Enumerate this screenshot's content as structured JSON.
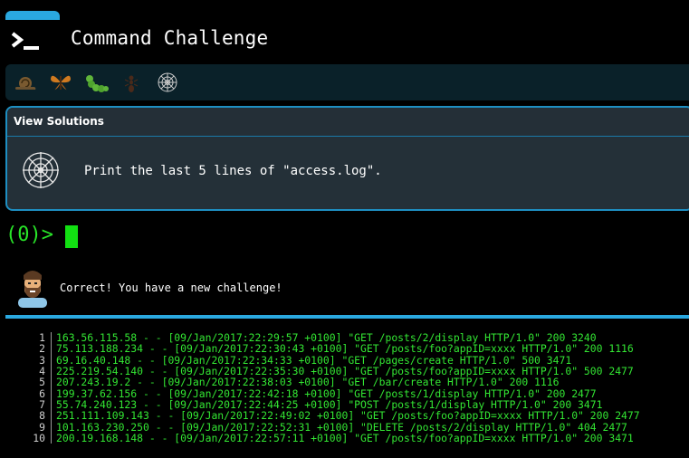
{
  "app": {
    "title": "Command Challenge"
  },
  "badges": [
    {
      "name": "snail-badge",
      "icon": "snail-icon"
    },
    {
      "name": "butterfly-badge",
      "icon": "butterfly-icon"
    },
    {
      "name": "caterpillar-badge",
      "icon": "caterpillar-icon"
    },
    {
      "name": "ant-badge",
      "icon": "ant-icon"
    },
    {
      "name": "spiderweb-badge",
      "icon": "spiderweb-icon"
    }
  ],
  "panel": {
    "header": "View Solutions",
    "icon": "spiderweb-icon",
    "challenge": "Print the last 5 lines of \"access.log\"."
  },
  "terminal": {
    "prompt": "(0)>"
  },
  "feedback": {
    "icon": "bearded-man-icon",
    "message": "Correct! You have a new challenge!"
  },
  "colors": {
    "accent": "#2aa8e0",
    "terminal_green": "#33e633",
    "panel_bg": "#243038",
    "badge_bar_bg": "#0a2129"
  },
  "output": {
    "lines": [
      {
        "num": "1",
        "text": "163.56.115.58 - - [09/Jan/2017:22:29:57 +0100] \"GET /posts/2/display HTTP/1.0\" 200 3240"
      },
      {
        "num": "2",
        "text": "75.113.188.234 - - [09/Jan/2017:22:30:43 +0100] \"GET /posts/foo?appID=xxxx HTTP/1.0\" 200 1116"
      },
      {
        "num": "3",
        "text": "69.16.40.148 - - [09/Jan/2017:22:34:33 +0100] \"GET /pages/create HTTP/1.0\" 500 3471"
      },
      {
        "num": "4",
        "text": "225.219.54.140 - - [09/Jan/2017:22:35:30 +0100] \"GET /posts/foo?appID=xxxx HTTP/1.0\" 500 2477"
      },
      {
        "num": "5",
        "text": "207.243.19.2 - - [09/Jan/2017:22:38:03 +0100] \"GET /bar/create HTTP/1.0\" 200 1116"
      },
      {
        "num": "6",
        "text": "199.37.62.156 - - [09/Jan/2017:22:42:18 +0100] \"GET /posts/1/display HTTP/1.0\" 200 2477"
      },
      {
        "num": "7",
        "text": "55.74.240.123 - - [09/Jan/2017:22:44:25 +0100] \"POST /posts/1/display HTTP/1.0\" 200 3471"
      },
      {
        "num": "8",
        "text": "251.111.109.143 - - [09/Jan/2017:22:49:02 +0100] \"GET /posts/foo?appID=xxxx HTTP/1.0\" 200 2477"
      },
      {
        "num": "9",
        "text": "101.163.230.250 - - [09/Jan/2017:22:52:31 +0100] \"DELETE /posts/2/display HTTP/1.0\" 404 2477"
      },
      {
        "num": "10",
        "text": "200.19.168.148 - - [09/Jan/2017:22:57:11 +0100] \"GET /posts/foo?appID=xxxx HTTP/1.0\" 200 3471"
      }
    ]
  }
}
